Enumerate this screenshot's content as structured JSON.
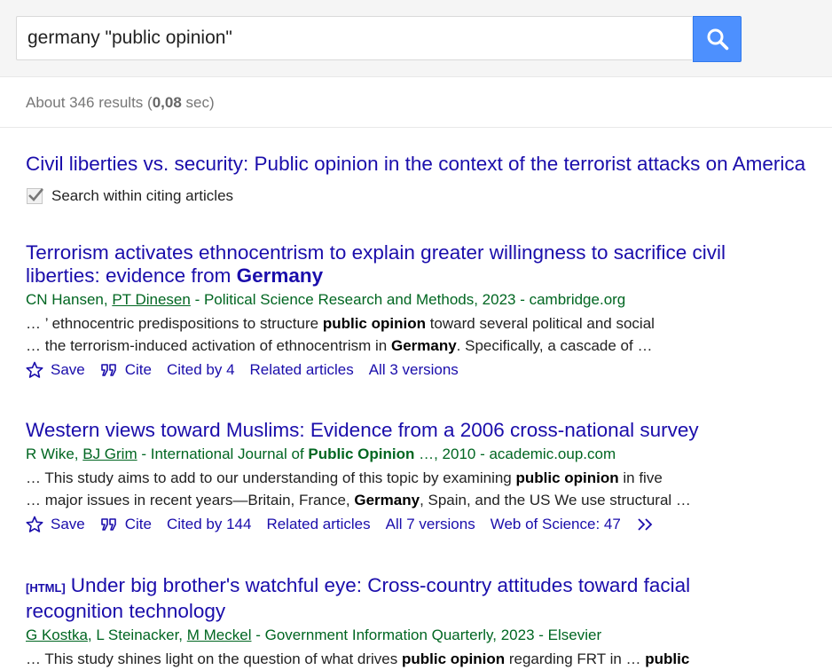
{
  "search": {
    "query": "germany \"public opinion\""
  },
  "stats": {
    "prefix": "About 346 results (",
    "time": "0,08",
    "suffix": " sec)"
  },
  "citing": {
    "title": "Civil liberties vs. security: Public opinion in the context of the terrorist attacks on America",
    "search_within_label": "Search within citing articles"
  },
  "results": [
    {
      "title_line1": "Terrorism activates ethnocentrism to explain greater willingness to sacrifice civil",
      "title_line2_pre": "liberties: evidence from ",
      "title_line2_bold": "Germany",
      "author1": "CN Hansen",
      "author_sep": ", ",
      "author2": "PT Dinesen",
      "source": " - Political Science Research and Methods, 2023 - cambridge.org",
      "s1_pre": "… ’ ethnocentric predispositions to structure ",
      "s1_bold": "public opinion",
      "s1_post": " toward several political and social",
      "s2_pre": "… the terrorism-induced activation of ethnocentrism in ",
      "s2_bold": "Germany",
      "s2_post": ". Specifically, a cascade of …",
      "save": "Save",
      "cite": "Cite",
      "cited_by": "Cited by 4",
      "related": "Related articles",
      "versions": "All 3 versions"
    },
    {
      "title": "Western views toward Muslims: Evidence from a 2006 cross-national survey",
      "author1": "R Wike",
      "author_sep": ", ",
      "author2": "BJ Grim",
      "src_pre": " - International Journal of ",
      "src_bold": "Public Opinion",
      "src_post": " …, 2010 - academic.oup.com",
      "s1_pre": "… This study aims to add to our understanding of this topic by examining ",
      "s1_bold": "public opinion",
      "s1_post": " in five",
      "s2_pre": "… major issues in recent years—Britain, France, ",
      "s2_bold": "Germany",
      "s2_post": ", Spain, and the US We use structural …",
      "save": "Save",
      "cite": "Cite",
      "cited_by": "Cited by 144",
      "related": "Related articles",
      "versions": "All 7 versions",
      "wos": "Web of Science: 47"
    },
    {
      "tag": "[HTML]",
      "title_line1": "Under big brother's watchful eye: Cross-country attitudes toward facial",
      "title_line2": "recognition technology",
      "author1": "G Kostka",
      "sep1": ", L Steinacker, ",
      "author3": "M Meckel",
      "source": " - Government Information Quarterly, 2023 - Elsevier",
      "s1_pre": "… This study shines light on the question of what drives ",
      "s1_bold": "public opinion",
      "s1_mid": " regarding FRT in … ",
      "s1_bold2": "public"
    }
  ],
  "icons": {
    "search": "search-icon",
    "save": "star-icon",
    "cite": "quote-icon",
    "more": "double-chevron-icon",
    "check": "checkmark-icon"
  },
  "colors": {
    "link": "#1a0dab",
    "green": "#006621",
    "search_button": "#4d90fe"
  }
}
